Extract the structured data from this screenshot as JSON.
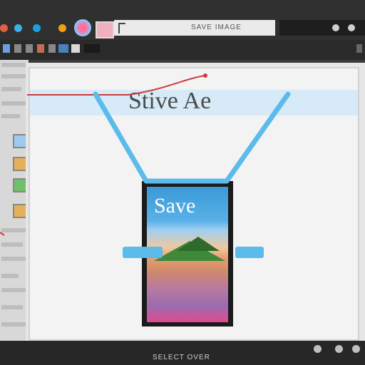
{
  "header": {
    "address_text": "SAVE IMAGE"
  },
  "dialog": {
    "title": "Stive Ae"
  },
  "phone": {
    "screen_title": "Save"
  },
  "footer": {
    "status_text": "SELECT OVER"
  },
  "colors": {
    "accent_line": "#5bbbea",
    "red_line": "#d03a3a",
    "header_strip": "#d6ebf7"
  },
  "icons": [
    "close-icon",
    "browser-icon",
    "refresh-icon",
    "settings-icon",
    "photo-icon"
  ]
}
